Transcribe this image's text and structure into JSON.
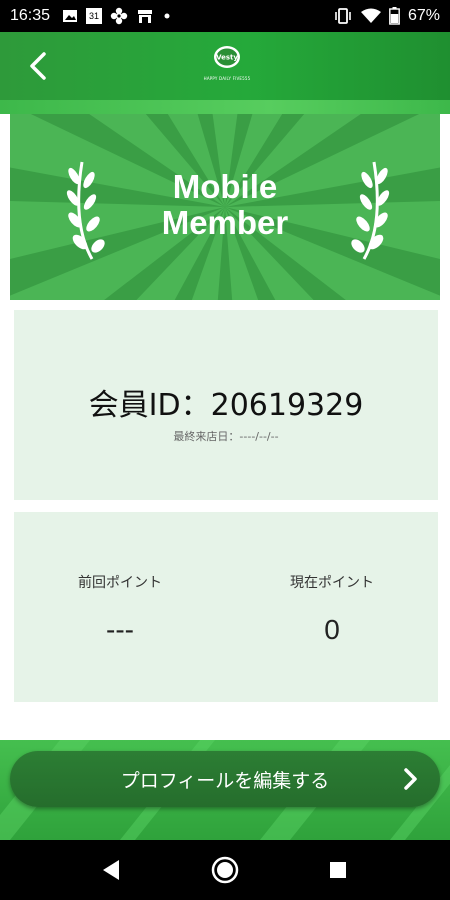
{
  "status_bar": {
    "time": "16:35",
    "battery": "67%",
    "icons": [
      "image-icon",
      "calendar-icon",
      "settings-flower-icon",
      "store-icon",
      "dot-icon",
      "vibrate-icon",
      "wifi-icon",
      "battery-icon"
    ],
    "calendar_day": "31"
  },
  "header": {
    "back_icon": "chevron-left-icon",
    "logo_text": "Vesty",
    "logo_subtext": "HAPPY DAILY FIVE555"
  },
  "banner": {
    "title_line1": "Mobile",
    "title_line2": "Member"
  },
  "member": {
    "id_text": "会員ID：20619329",
    "last_visit": "最終来店日：----/--/--"
  },
  "points": {
    "previous_label": "前回ポイント",
    "previous_value": "---",
    "current_label": "現在ポイント",
    "current_value": "0"
  },
  "footer": {
    "edit_button_label": "プロフィールを編集する"
  },
  "colors": {
    "primary_green": "#25a93a",
    "banner_green": "#3da548",
    "card_bg": "#e6f3e8",
    "button_green": "#2a7a32"
  }
}
